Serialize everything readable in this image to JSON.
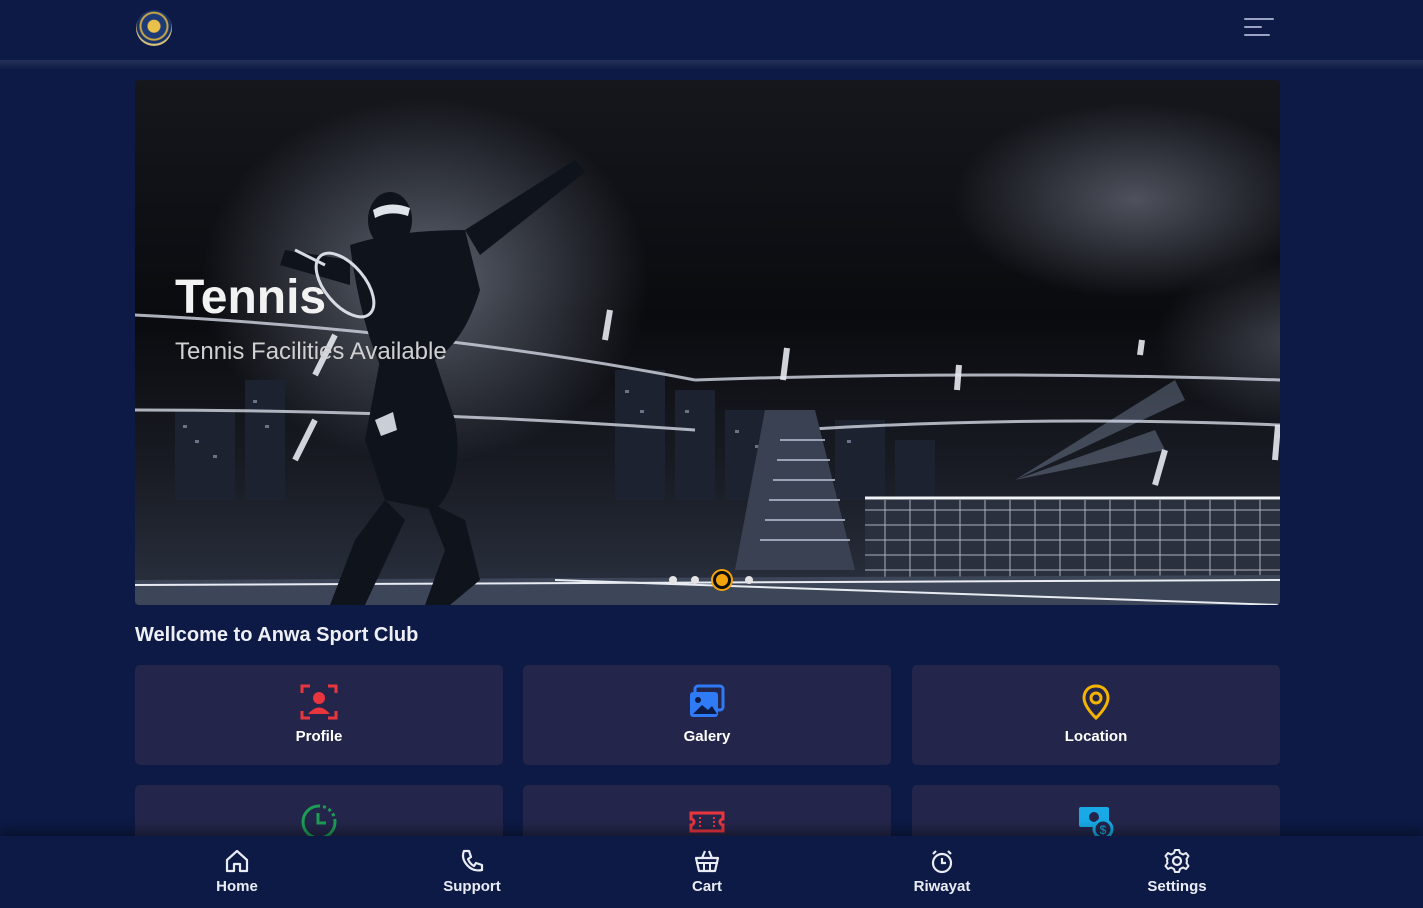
{
  "header": {
    "logo_icon": "anwa-club-logo",
    "menu_icon": "menu-icon"
  },
  "hero": {
    "title": "Tennis",
    "subtitle": "Tennis Facilities Available",
    "slide_count": 4,
    "active_slide": 3
  },
  "welcome": "Wellcome to Anwa Sport Club",
  "cards": [
    {
      "label": "Profile",
      "icon": "profile-icon",
      "color": "#e8353e"
    },
    {
      "label": "Galery",
      "icon": "gallery-icon",
      "color": "#2f7bf5"
    },
    {
      "label": "Location",
      "icon": "location-pin-icon",
      "color": "#f4b400"
    },
    {
      "label": "",
      "icon": "clock-icon",
      "color": "#1e9e55"
    },
    {
      "label": "",
      "icon": "ticket-icon",
      "color": "#e8353e"
    },
    {
      "label": "",
      "icon": "money-icon",
      "color": "#18a9e6"
    }
  ],
  "bottom_nav": [
    {
      "label": "Home",
      "icon": "home-icon"
    },
    {
      "label": "Support",
      "icon": "phone-icon"
    },
    {
      "label": "Cart",
      "icon": "basket-icon"
    },
    {
      "label": "Riwayat",
      "icon": "stopwatch-icon"
    },
    {
      "label": "Settings",
      "icon": "gear-icon"
    }
  ]
}
